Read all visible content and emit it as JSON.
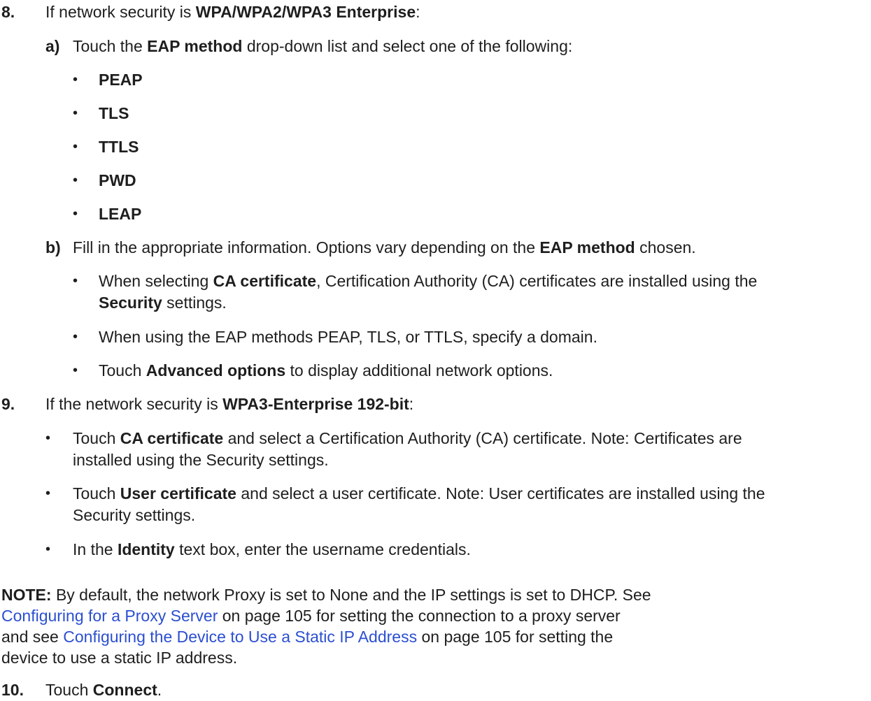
{
  "step8": {
    "number": "8.",
    "text_pre": "If network security is ",
    "text_bold": "WPA/WPA2/WPA3 Enterprise",
    "text_post": ":",
    "sub_a": {
      "label": "a)",
      "pre": "Touch the ",
      "bold": "EAP method",
      "post": " drop-down list and select one of the following:",
      "options": [
        "PEAP",
        "TLS",
        "TTLS",
        "PWD",
        "LEAP"
      ]
    },
    "sub_b": {
      "label": "b)",
      "pre": "Fill in the appropriate information. Options vary depending on the ",
      "bold": "EAP method",
      "post": " chosen.",
      "bullet1": {
        "pre": "When selecting ",
        "bold1": "CA certificate",
        "mid": ", Certification Authority (CA) certificates are installed using the",
        "bold2": "Security",
        "post": " settings."
      },
      "bullet2": "When using the EAP methods PEAP, TLS, or TTLS, specify a domain.",
      "bullet3": {
        "pre": "Touch ",
        "bold": "Advanced options",
        "post": " to display additional network options."
      }
    }
  },
  "step9": {
    "number": "9.",
    "text_pre": "If the network security is ",
    "text_bold": "WPA3-Enterprise 192-bit",
    "text_post": ":",
    "bullet1": {
      "pre": "Touch ",
      "bold": "CA certificate",
      "post": " and select a Certification Authority (CA) certificate. Note: Certificates are",
      "line2": "installed using the Security settings."
    },
    "bullet2": {
      "pre": "Touch ",
      "bold": "User certificate",
      "post": " and select a user certificate. Note: User certificates are installed using the",
      "line2": "Security settings."
    },
    "bullet3": {
      "pre": "In the ",
      "bold": "Identity",
      "post": " text box, enter the username credentials."
    }
  },
  "note": {
    "label": "NOTE:",
    "line1": " By default, the network Proxy is set to None and the IP settings is set to DHCP. See",
    "link1": "Configuring for a Proxy Server",
    "line2_post": " on page 105 for setting the connection to a proxy server",
    "line3_pre": "and see ",
    "link2": "Configuring the Device to Use a Static IP Address",
    "line3_post": " on page 105 for setting the",
    "line4": "device to use a static IP address."
  },
  "step10": {
    "number": "10.",
    "pre": "Touch ",
    "bold": "Connect",
    "post": "."
  }
}
